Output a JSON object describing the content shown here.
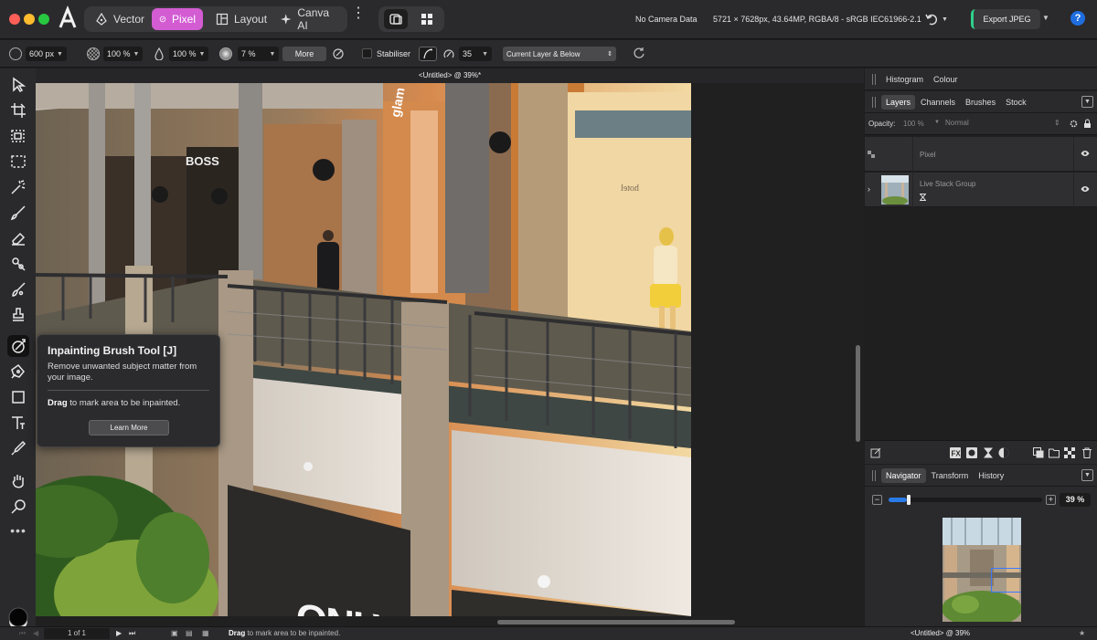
{
  "titlebar": {
    "personas": [
      {
        "label": "Vector",
        "icon": "vector-pen-icon"
      },
      {
        "label": "Pixel",
        "icon": "pixel-brush-icon",
        "active": true
      },
      {
        "label": "Layout",
        "icon": "layout-pages-icon"
      },
      {
        "label": "Canva AI",
        "icon": "sparkle-icon"
      }
    ],
    "camera_info": "No Camera Data",
    "document_info": "5721 × 7628px, 43.64MP, RGBA/8 - sRGB IEC61966-2.1",
    "export_label": "Export JPEG",
    "help_label": "?",
    "accent_color": "#d35cd3"
  },
  "context_toolbar": {
    "width_value": "600 px",
    "opacity_value": "100 %",
    "flow_value": "100 %",
    "hardness_value": "7 %",
    "more_label": "More",
    "stabiliser_label": "Stabiliser",
    "stabiliser_value": "35",
    "layer_source": "Current Layer & Below"
  },
  "document": {
    "tab_title": "<Untitled> @ 39%*"
  },
  "tooltip": {
    "title": "Inpainting Brush Tool [J]",
    "description": "Remove unwanted subject matter from your image.",
    "hint_bold": "Drag",
    "hint_rest": " to mark area to be inpainted.",
    "learn_more": "Learn More"
  },
  "panels": {
    "top_tabs": [
      "Histogram",
      "Colour"
    ],
    "layers_tabs": [
      "Layers",
      "Channels",
      "Brushes",
      "Stock"
    ],
    "opacity_label": "Opacity:",
    "opacity_value": "100 %",
    "blend_mode": "Normal",
    "layers": [
      {
        "name": "Pixel"
      },
      {
        "name": "Live Stack Group"
      }
    ],
    "nav_tabs": [
      "Navigator",
      "Transform",
      "History"
    ],
    "zoom_value": "39 %",
    "zoom_fraction": 0.12
  },
  "statusbar": {
    "page_indicator": "1 of 1",
    "hint_bold": "Drag",
    "hint_rest": " to mark area to be inpainted.",
    "doc_title": "<Untitled> @ 39%"
  }
}
